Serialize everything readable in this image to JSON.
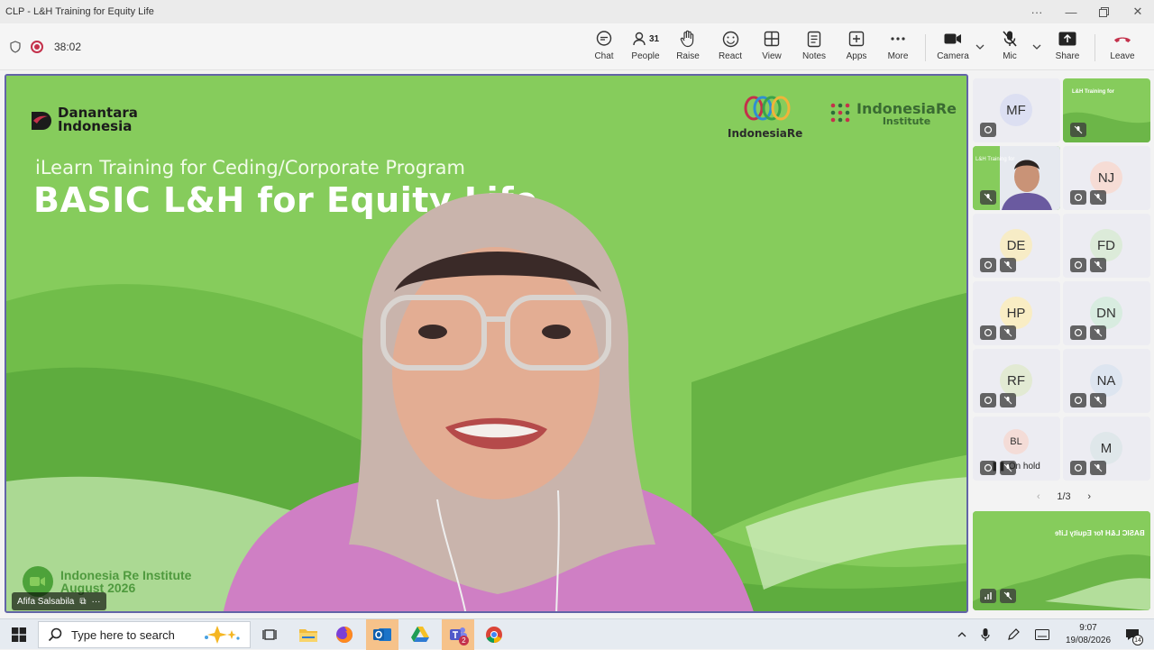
{
  "window": {
    "title": "CLP - L&H Training for Equity Life",
    "controls": [
      "more-icon",
      "minimize-icon",
      "restore-icon",
      "close-icon"
    ]
  },
  "toolbar": {
    "timer": "38:02",
    "chat": "Chat",
    "people": "People",
    "people_count": "31",
    "raise": "Raise",
    "react": "React",
    "view": "View",
    "notes": "Notes",
    "apps": "Apps",
    "more": "More",
    "camera": "Camera",
    "mic": "Mic",
    "share": "Share",
    "leave": "Leave"
  },
  "stage": {
    "brand_left_line1": "Danantara",
    "brand_left_line2": "Indonesia",
    "brand_mid": "IndonesiaRe",
    "brand_right_line1": "IndonesiaRe",
    "brand_right_line2": "Institute",
    "subtitle": "iLearn Training for Ceding/Corporate Program",
    "title": "BASIC L&H for Equity Life",
    "institute": "Indonesia Re Institute",
    "date": "August 2026",
    "speaker_name": "Afifa Salsabila"
  },
  "gallery": {
    "tiles": [
      {
        "initials": "MF",
        "color": "#dcdff2"
      },
      {
        "initials": "",
        "color": "#86cc5c"
      },
      {
        "initials": "",
        "color": "#6f8ba8"
      },
      {
        "initials": "NJ",
        "color": "#f6dcd5"
      },
      {
        "initials": "DE",
        "color": "#f7ecc6"
      },
      {
        "initials": "FD",
        "color": "#dcebd9"
      },
      {
        "initials": "HP",
        "color": "#f9edc4"
      },
      {
        "initials": "DN",
        "color": "#d8ece0"
      },
      {
        "initials": "RF",
        "color": "#e2ead3"
      },
      {
        "initials": "NA",
        "color": "#dde5f0"
      },
      {
        "initials": "BL",
        "color": "#f4dcd7"
      },
      {
        "initials": "M",
        "color": "#dfe7ea"
      }
    ],
    "onhold_text": "On hold",
    "thumb_title": "L&H Training for",
    "page": "1/3",
    "preview_title": "BASIC L&H for Equity Life"
  },
  "taskbar": {
    "search_placeholder": "Type here to search",
    "time": "9:07",
    "date": "19/08/2026",
    "notif_count": "14",
    "teams_badge": "2"
  },
  "colors": {
    "accent": "#6264a7",
    "leave_red": "#c4314b",
    "slide_green": "#86cc5c"
  }
}
